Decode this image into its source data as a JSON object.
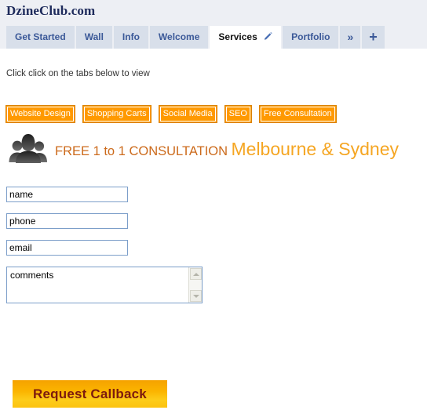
{
  "header": {
    "site_title": "DzineClub.com",
    "tabs": [
      {
        "label": "Get Started",
        "active": false,
        "name": "tab-get-started"
      },
      {
        "label": "Wall",
        "active": false,
        "name": "tab-wall"
      },
      {
        "label": "Info",
        "active": false,
        "name": "tab-info"
      },
      {
        "label": "Welcome",
        "active": false,
        "name": "tab-welcome"
      },
      {
        "label": "Services",
        "active": true,
        "name": "tab-services"
      },
      {
        "label": "Portfolio",
        "active": false,
        "name": "tab-portfolio"
      }
    ],
    "more_tabs_glyph": "»",
    "add_tab_glyph": "+"
  },
  "main": {
    "hint": "Click click on the tabs below to view",
    "chips": [
      {
        "label": "Website Design",
        "name": "chip-website-design"
      },
      {
        "label": "Shopping Carts",
        "name": "chip-shopping-carts"
      },
      {
        "label": "Social Media",
        "name": "chip-social-media"
      },
      {
        "label": "SEO",
        "name": "chip-seo"
      },
      {
        "label": "Free Consultation",
        "name": "chip-free-consultation"
      }
    ],
    "headline": {
      "line1": "FREE 1 to 1 CONSULTATION",
      "line2": "Melbourne & Sydney",
      "line1_color": "#cc6a1b",
      "line2_color": "#f5a623"
    },
    "form": {
      "name_value": "name",
      "phone_value": "phone",
      "email_value": "email",
      "comments_value": "comments",
      "submit_label": "Request Callback"
    }
  },
  "colors": {
    "chrome_bg": "#edeff4",
    "tab_bg": "#d8dfea",
    "tab_text": "#3b5998",
    "chip_bg": "#ff9900",
    "cta_text": "#7d1b0e"
  }
}
